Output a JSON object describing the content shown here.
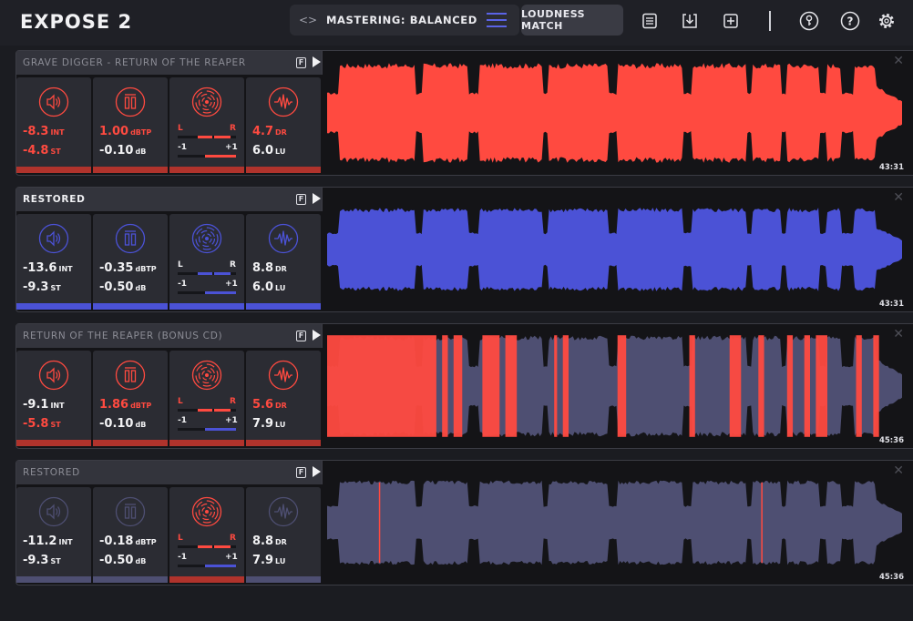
{
  "app": {
    "title": "EXPOSE 2"
  },
  "toolbar": {
    "preset_label": "MASTERING: BALANCED",
    "loudness_match_label": "LOUDNESS MATCH",
    "icons": [
      "nav-arrows-icon",
      "menu-icon",
      "list-icon",
      "download-icon",
      "add-icon",
      "key-icon",
      "help-icon",
      "settings-icon"
    ]
  },
  "colors": {
    "red": "#ff4a40",
    "blue": "#4b52d6",
    "grey": "#4e4f72",
    "bar_red": "#b0332c",
    "bar_blue": "#4b52d6",
    "bar_grey": "#4e4f72"
  },
  "tracks": [
    {
      "title": "GRAVE DIGGER - RETURN OF THE REAPER",
      "title_active": false,
      "f_label": "F",
      "integrated": "-8.3",
      "integrated_unit": "INT",
      "short_term": "-4.8",
      "short_term_unit": "ST",
      "true_peak": "1.00",
      "true_peak_unit": "dBTP",
      "peak_db": "-0.10",
      "peak_db_unit": "dB",
      "dynamic_range": "4.7",
      "dynamic_range_unit": "DR",
      "lu": "6.0",
      "lu_unit": "LU",
      "balance_left": "L",
      "balance_right": "R",
      "corr_min": "-1",
      "corr_max": "+1",
      "duration": "43:31",
      "accent": "red"
    },
    {
      "title": "RESTORED",
      "title_active": true,
      "f_label": "F",
      "integrated": "-13.6",
      "integrated_unit": "INT",
      "short_term": "-9.3",
      "short_term_unit": "ST",
      "true_peak": "-0.35",
      "true_peak_unit": "dBTP",
      "peak_db": "-0.50",
      "peak_db_unit": "dB",
      "dynamic_range": "8.8",
      "dynamic_range_unit": "DR",
      "lu": "6.0",
      "lu_unit": "LU",
      "balance_left": "L",
      "balance_right": "R",
      "corr_min": "-1",
      "corr_max": "+1",
      "duration": "43:31",
      "accent": "blue"
    },
    {
      "title": "RETURN OF THE REAPER (BONUS CD)",
      "title_active": false,
      "f_label": "F",
      "integrated": "-9.1",
      "integrated_unit": "INT",
      "short_term": "-5.8",
      "short_term_unit": "ST",
      "true_peak": "1.86",
      "true_peak_unit": "dBTP",
      "peak_db": "-0.10",
      "peak_db_unit": "dB",
      "dynamic_range": "5.6",
      "dynamic_range_unit": "DR",
      "lu": "7.9",
      "lu_unit": "LU",
      "balance_left": "L",
      "balance_right": "R",
      "corr_min": "-1",
      "corr_max": "+1",
      "duration": "45:36",
      "accent": "mixed"
    },
    {
      "title": "RESTORED",
      "title_active": false,
      "f_label": "F",
      "integrated": "-11.2",
      "integrated_unit": "INT",
      "short_term": "-9.3",
      "short_term_unit": "ST",
      "true_peak": "-0.18",
      "true_peak_unit": "dBTP",
      "peak_db": "-0.50",
      "peak_db_unit": "dB",
      "dynamic_range": "8.8",
      "dynamic_range_unit": "DR",
      "lu": "7.9",
      "lu_unit": "LU",
      "balance_left": "L",
      "balance_right": "R",
      "corr_min": "-1",
      "corr_max": "+1",
      "duration": "45:36",
      "accent": "grey"
    }
  ]
}
